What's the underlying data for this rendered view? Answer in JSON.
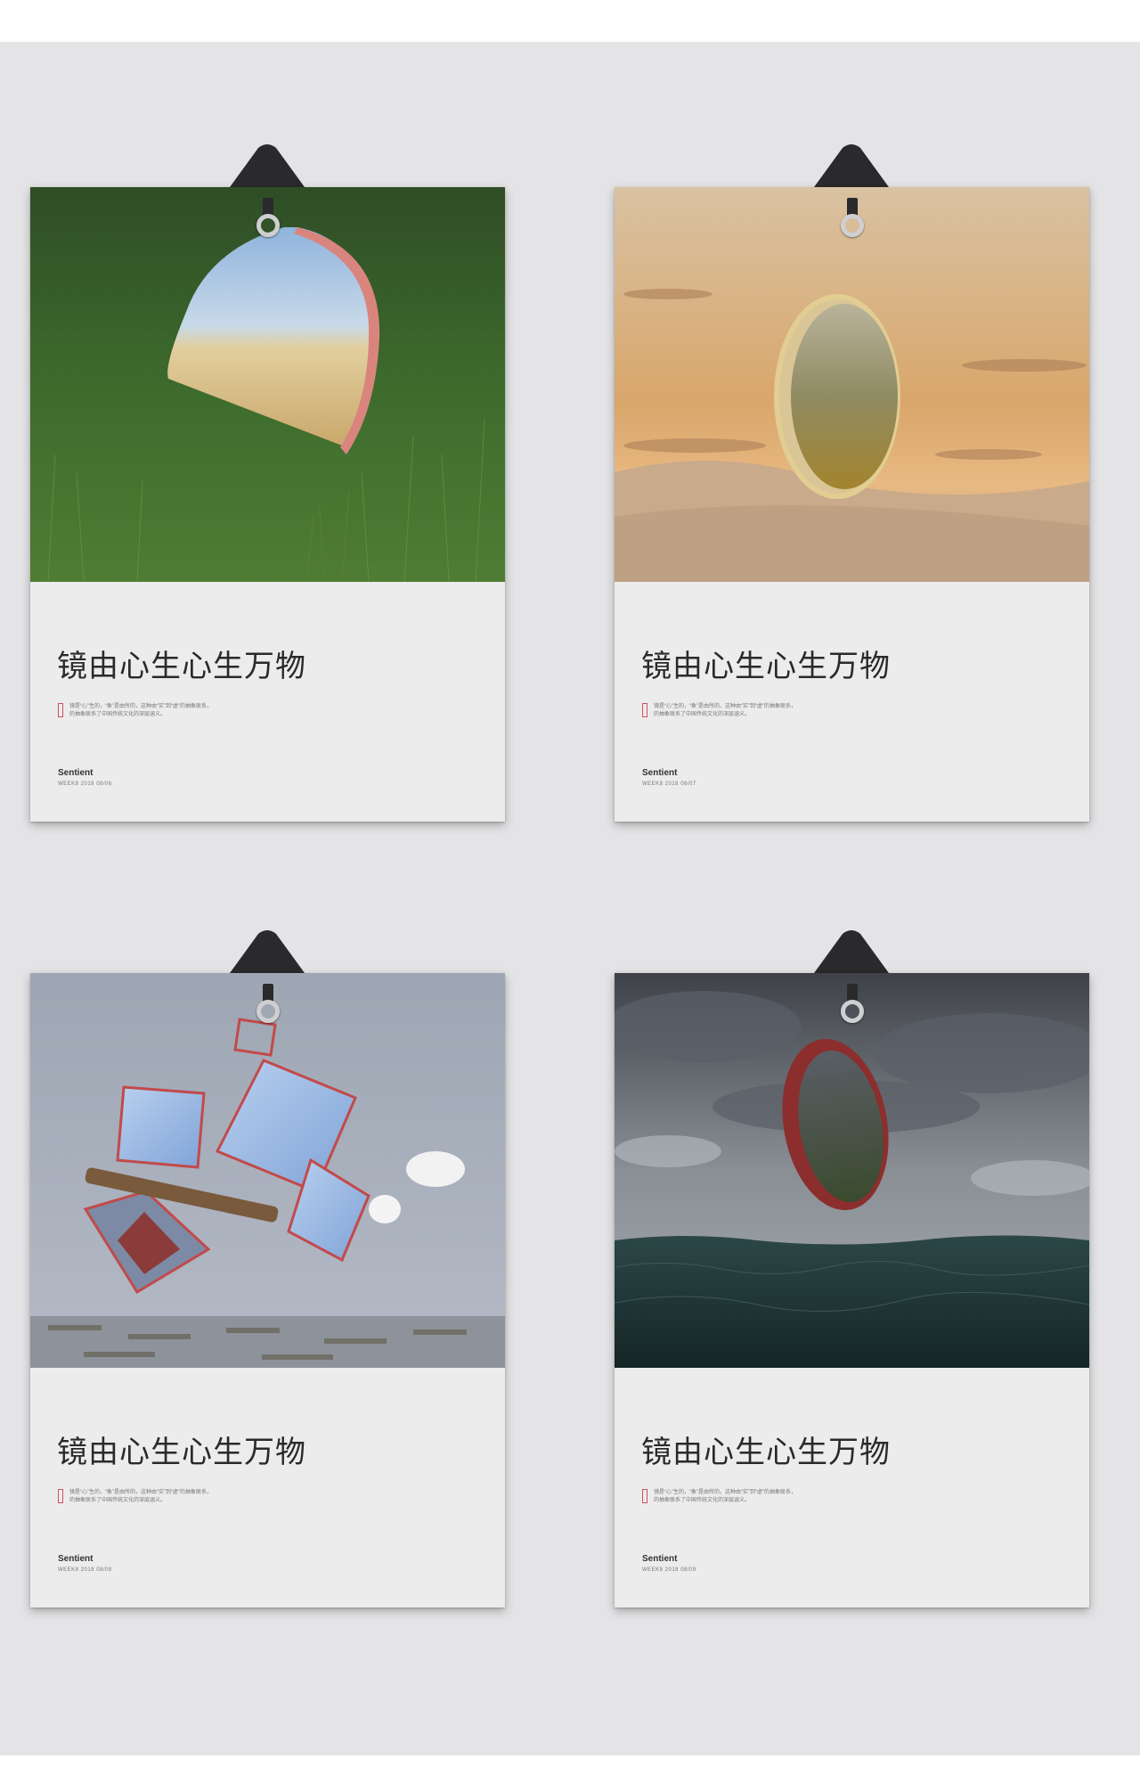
{
  "posters": [
    {
      "scene": "grass-field-round-mirror",
      "title": "镜由心生心生万物",
      "desc_line1": "镜是“心”生的，“象”是由所的，这种由“实”到“虚”的抽象联系，",
      "desc_line2": "的抽象联系了中国传统文化的深层涵义。",
      "brand": "Sentient",
      "meta": "WEEK8  2018  08/06"
    },
    {
      "scene": "desert-sunset-mirror",
      "title": "镜由心生心生万物",
      "desc_line1": "镜是“心”生的，“象”是由所的，这种由“实”到“虚”的抽象联系，",
      "desc_line2": "的抽象联系了中国传统文化的深层涵义。",
      "brand": "Sentient",
      "meta": "WEEK8  2018  08/07"
    },
    {
      "scene": "concrete-wall-floating-mirrors",
      "title": "镜由心生心生万物",
      "desc_line1": "镜是“心”生的，“象”是由所的，这种由“实”到“虚”的抽象联系，",
      "desc_line2": "的抽象联系了中国传统文化的深层涵义。",
      "brand": "Sentient",
      "meta": "WEEK8  2018  08/08"
    },
    {
      "scene": "stormy-sea-mirror",
      "title": "镜由心生心生万物",
      "desc_line1": "镜是“心”生的，“象”是由所的，这种由“实”到“虚”的抽象联系，",
      "desc_line2": "的抽象联系了中国传统文化的深层涵义。",
      "brand": "Sentient",
      "meta": "WEEK8  2018  08/09"
    }
  ],
  "colors": {
    "wall": "#e4e4e6",
    "paper": "#ececed",
    "accent_red": "#d0505a",
    "clip": "#2a2a2c"
  }
}
